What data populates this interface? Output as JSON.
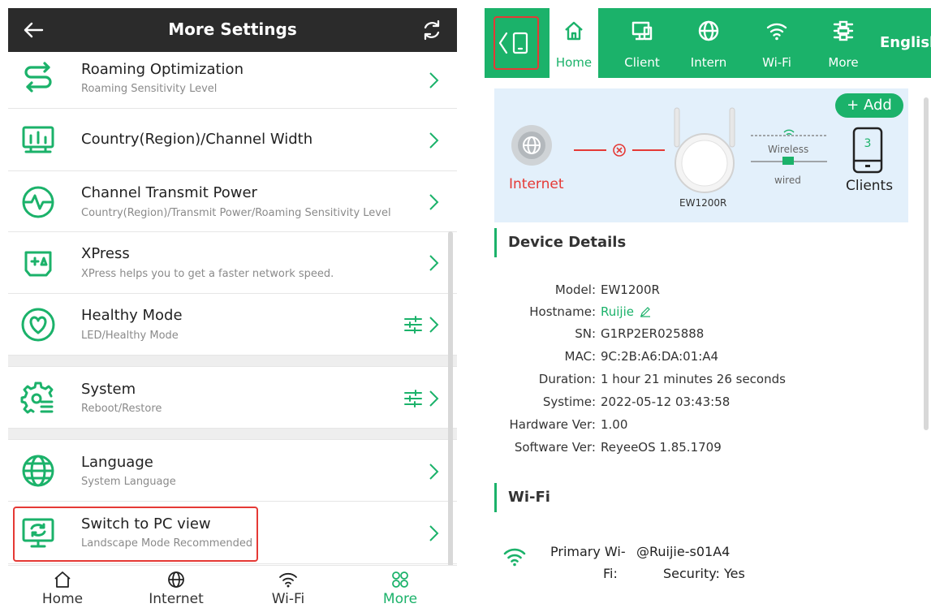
{
  "left": {
    "header": {
      "title": "More Settings"
    },
    "items": [
      {
        "label": "Roaming Optimization",
        "sub": "Roaming Sensitivity Level"
      },
      {
        "label": "Country(Region)/Channel Width",
        "sub": ""
      },
      {
        "label": "Channel Transmit Power",
        "sub": "Country(Region)/Transmit Power/Roaming Sensitivity Level"
      },
      {
        "label": "XPress",
        "sub": "XPress helps you to get a faster network speed."
      },
      {
        "label": "Healthy Mode",
        "sub": "LED/Healthy Mode"
      },
      {
        "label": "System",
        "sub": "Reboot/Restore"
      },
      {
        "label": "Language",
        "sub": "System Language"
      },
      {
        "label": "Switch to PC view",
        "sub": "Landscape Mode Recommended"
      }
    ],
    "tabs": [
      {
        "label": "Home"
      },
      {
        "label": "Internet"
      },
      {
        "label": "Wi-Fi"
      },
      {
        "label": "More"
      }
    ]
  },
  "right": {
    "nav": {
      "tabs": [
        {
          "label": "Home"
        },
        {
          "label": "Client"
        },
        {
          "label": "Intern"
        },
        {
          "label": "Wi-Fi"
        },
        {
          "label": "More"
        }
      ],
      "language": "English"
    },
    "topology": {
      "add_label": "+ Add",
      "internet_label": "Internet",
      "device_label": "EW1200R",
      "wireless_label": "Wireless",
      "wired_label": "wired",
      "clients_count": "3",
      "clients_label": "Clients"
    },
    "device_details": {
      "title": "Device Details",
      "rows": [
        {
          "key": "Model:",
          "value": "EW1200R"
        },
        {
          "key": "Hostname:",
          "value": "Ruijie"
        },
        {
          "key": "SN:",
          "value": "G1RP2ER025888"
        },
        {
          "key": "MAC:",
          "value": "9C:2B:A6:DA:01:A4"
        },
        {
          "key": "Duration:",
          "value": "1 hour 21 minutes 26 seconds"
        },
        {
          "key": "Systime:",
          "value": "2022-05-12 03:43:58"
        },
        {
          "key": "Hardware Ver:",
          "value": "1.00"
        },
        {
          "key": "Software Ver:",
          "value": "ReyeeOS 1.85.1709"
        }
      ]
    },
    "wifi": {
      "title": "Wi-Fi",
      "primary_label_1": "Primary Wi-",
      "primary_label_2": "Fi:",
      "ssid": "@Ruijie-s01A4",
      "security": "Security: Yes"
    }
  },
  "colors": {
    "accent": "#1bb26a",
    "highlight": "#e53935",
    "header_dark": "#2b2b2b",
    "topology_bg": "#e3f0fb"
  }
}
